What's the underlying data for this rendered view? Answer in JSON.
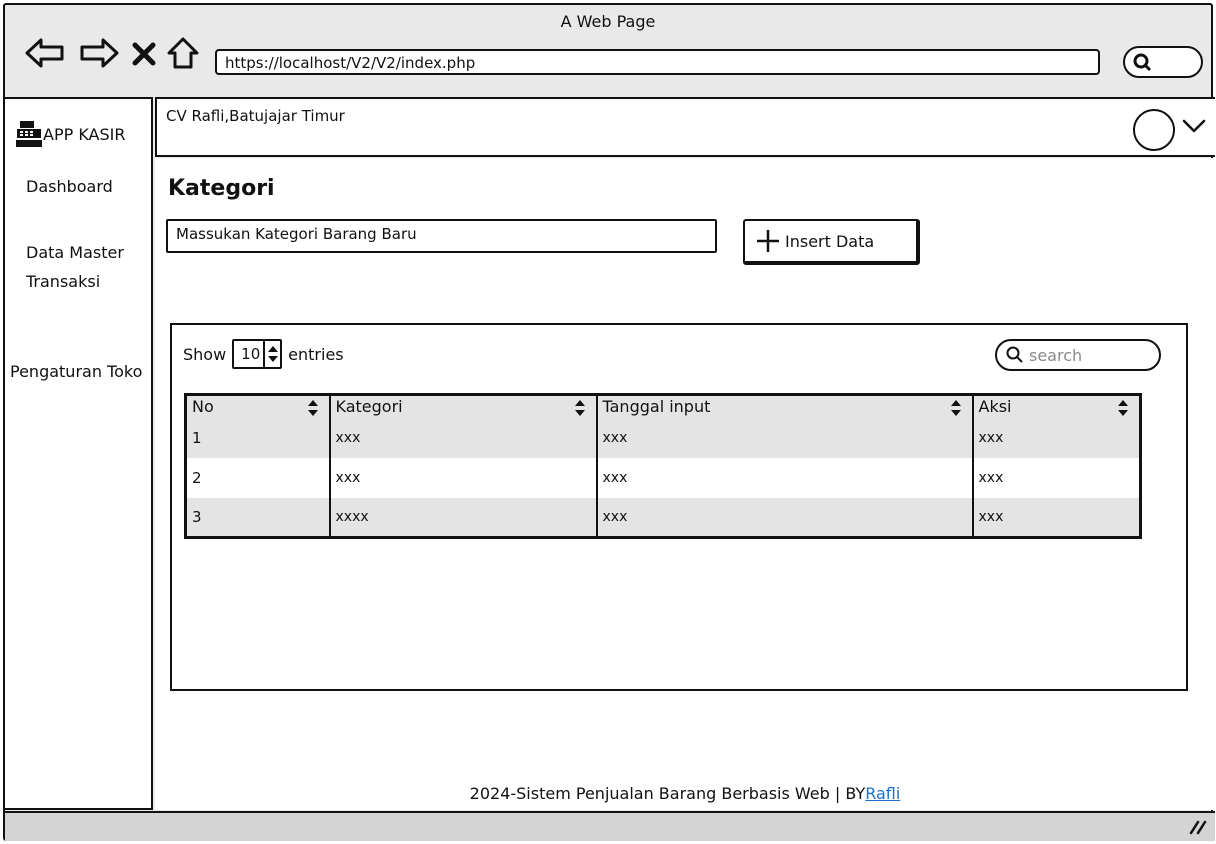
{
  "browser": {
    "window_title": "A Web Page",
    "url": "https://localhost/V2/V2/index.php",
    "icons": [
      "back-arrow-icon",
      "forward-arrow-icon",
      "close-x-icon",
      "home-icon",
      "search-icon"
    ]
  },
  "sidebar": {
    "brand": "APP KASIR",
    "brand_icon": "cash-register-icon",
    "items": [
      {
        "label": "Dashboard"
      },
      {
        "label": "Data Master"
      },
      {
        "label": "Transaksi"
      },
      {
        "label": "Pengaturan Toko"
      }
    ]
  },
  "topbar": {
    "store_name": "CV Rafli,Batujajar Timur",
    "avatar_icon": "user-avatar-icon"
  },
  "main": {
    "title": "Kategori",
    "input_placeholder": "Massukan Kategori Barang Baru",
    "insert_button": "Insert Data",
    "insert_icon": "plus-icon",
    "table": {
      "show_label": "Show",
      "entries_value": "10",
      "entries_label": "entries",
      "search_placeholder": "search",
      "columns": [
        "No",
        "Kategori",
        "Tanggal input",
        "Aksi"
      ],
      "rows": [
        [
          "1",
          "xxx",
          "xxx",
          "xxx"
        ],
        [
          "2",
          "xxx",
          "xxx",
          "xxx"
        ],
        [
          "3",
          "xxxx",
          "xxx",
          "xxx"
        ]
      ]
    }
  },
  "footer": {
    "text": "2024-Sistem Penjualan Barang Berbasis Web | BY",
    "link": "Rafli"
  },
  "colors": {
    "ink": "#111111",
    "chrome": "#e9e9e9",
    "row_alt": "#e4e4e4",
    "link": "#1a73c9",
    "placeholder": "#8a8a8a"
  }
}
